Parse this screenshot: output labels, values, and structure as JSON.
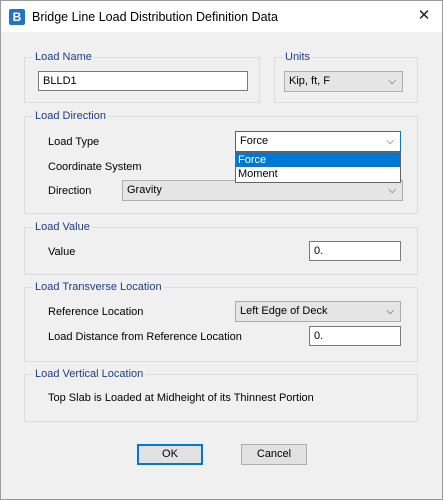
{
  "window": {
    "title": "Bridge Line Load Distribution Definition Data",
    "icon_letter": "B"
  },
  "load_name": {
    "legend": "Load Name",
    "value": "BLLD1"
  },
  "units": {
    "legend": "Units",
    "value": "Kip, ft, F"
  },
  "load_direction": {
    "legend": "Load Direction",
    "load_type_label": "Load Type",
    "load_type_value": "Force",
    "coordinate_system_label": "Coordinate System",
    "direction_label": "Direction",
    "direction_value": "Gravity",
    "load_type_options": [
      "Force",
      "Moment"
    ]
  },
  "load_value": {
    "legend": "Load Value",
    "value_label": "Value",
    "value": "0."
  },
  "load_transverse": {
    "legend": "Load Transverse Location",
    "reference_label": "Reference Location",
    "reference_value": "Left Edge of Deck",
    "distance_label": "Load Distance from Reference Location",
    "distance_value": "0."
  },
  "load_vertical": {
    "legend": "Load Vertical Location",
    "text": "Top Slab is Loaded at Midheight of its Thinnest Portion"
  },
  "buttons": {
    "ok": "OK",
    "cancel": "Cancel"
  },
  "icons": {
    "close": "close-icon",
    "chevron": "chevron-down-icon"
  }
}
